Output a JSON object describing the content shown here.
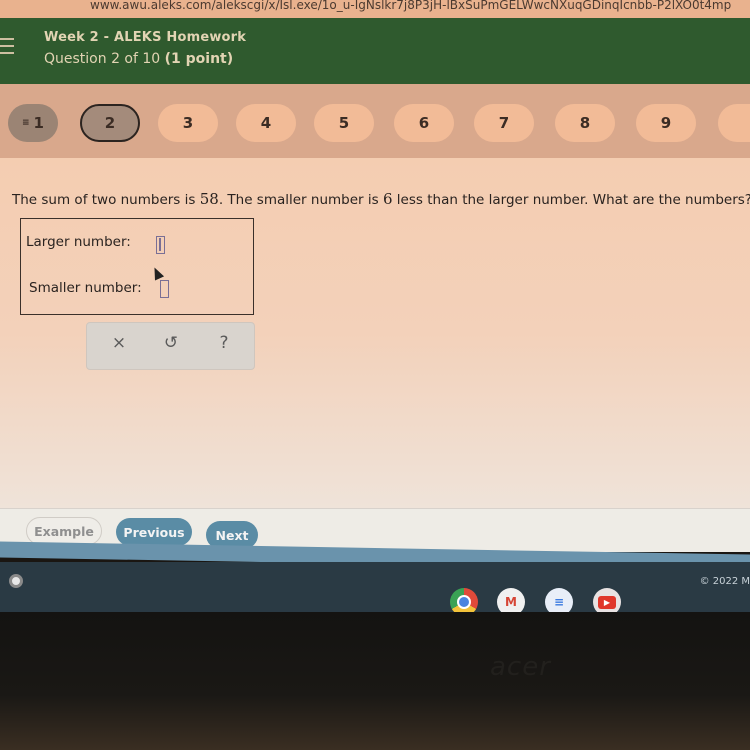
{
  "browser": {
    "url": "www.awu.aleks.com/alekscgi/x/Isl.exe/1o_u-IgNslkr7j8P3jH-lBxSuPmGELWwcNXuqGDinqIcnbb-P2lXO0t4mp"
  },
  "header": {
    "title": "Week 2 - ALEKS Homework",
    "question_prefix": "Question 2 of 10",
    "points": "(1 point)"
  },
  "question_nav": {
    "items": [
      {
        "label": "1",
        "state": "answered"
      },
      {
        "label": "2",
        "state": "current"
      },
      {
        "label": "3",
        "state": "unanswered"
      },
      {
        "label": "4",
        "state": "unanswered"
      },
      {
        "label": "5",
        "state": "unanswered"
      },
      {
        "label": "6",
        "state": "unanswered"
      },
      {
        "label": "7",
        "state": "unanswered"
      },
      {
        "label": "8",
        "state": "unanswered"
      },
      {
        "label": "9",
        "state": "unanswered"
      }
    ],
    "flag_icon": "flag-icon"
  },
  "question": {
    "part1": "The sum of two numbers is ",
    "sum": "58",
    "part2": ". The smaller number is ",
    "difference": "6",
    "part3": " less than the larger number. What are the numbers?"
  },
  "answers": {
    "larger_label": "Larger number:",
    "larger_value": "",
    "smaller_label": "Smaller number:",
    "smaller_value": ""
  },
  "tools": {
    "clear": "×",
    "undo": "↺",
    "help": "?"
  },
  "buttons": {
    "example": "Example",
    "previous": "Previous",
    "next": "Next"
  },
  "shelf": {
    "copyright": "© 2022 M",
    "apps": [
      "chrome",
      "gmail",
      "docs",
      "youtube"
    ],
    "gmail_glyph": "M",
    "docs_glyph": "≡",
    "youtube_glyph": "▶"
  },
  "bezel": {
    "brand": "acer"
  },
  "colors": {
    "header_bg": "#2f5a2e",
    "nav_button": "#5a8ca5",
    "pill": "#f2bb97"
  }
}
